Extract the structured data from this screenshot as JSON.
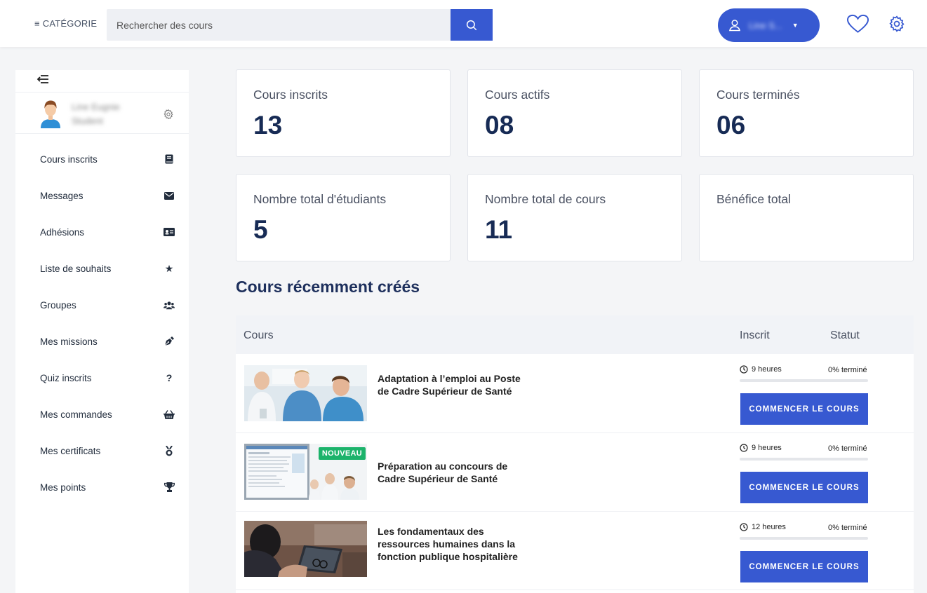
{
  "header": {
    "category_label": "CATÉGORIE",
    "search_placeholder": "Rechercher des cours",
    "user_name": "Line S..."
  },
  "sidebar": {
    "profile_name_line1": "Line Eugnie",
    "profile_name_line2": "Student",
    "items": [
      {
        "label": "Cours inscrits",
        "icon": "book-icon"
      },
      {
        "label": "Messages",
        "icon": "envelope-icon"
      },
      {
        "label": "Adhésions",
        "icon": "id-card-icon"
      },
      {
        "label": "Liste de souhaits",
        "icon": "star-icon"
      },
      {
        "label": "Groupes",
        "icon": "users-icon"
      },
      {
        "label": "Mes missions",
        "icon": "pen-nib-icon"
      },
      {
        "label": "Quiz inscrits",
        "icon": "question-icon"
      },
      {
        "label": "Mes commandes",
        "icon": "basket-icon"
      },
      {
        "label": "Mes certificats",
        "icon": "medal-icon"
      },
      {
        "label": "Mes points",
        "icon": "trophy-icon"
      }
    ]
  },
  "stats": [
    {
      "label": "Cours inscrits",
      "value": "13"
    },
    {
      "label": "Cours actifs",
      "value": "08"
    },
    {
      "label": "Cours terminés",
      "value": "06"
    },
    {
      "label": "Nombre total d'étudiants",
      "value": "5"
    },
    {
      "label": "Nombre total de cours",
      "value": "11"
    },
    {
      "label": "Bénéfice total",
      "value": ""
    }
  ],
  "recent": {
    "title": "Cours récemment créés",
    "col_course": "Cours",
    "col_enrolled": "Inscrit",
    "col_status": "Statut",
    "rows": [
      {
        "title": "Adaptation à l’emploi au Poste de Cadre Supérieur de Santé",
        "duration": "9 heures",
        "progress": "0% terminé",
        "progress_value": 0,
        "button": "COMMENCER LE COURS",
        "badge": ""
      },
      {
        "title": "Préparation au concours de Cadre Supérieur de Santé",
        "duration": "9 heures",
        "progress": "0% terminé",
        "progress_value": 0,
        "button": "COMMENCER LE COURS",
        "badge": "NOUVEAU"
      },
      {
        "title": "Les fondamentaux des ressources humaines dans la fonction publique hospitalière",
        "duration": "12 heures",
        "progress": "0% terminé",
        "progress_value": 0,
        "button": "COMMENCER LE COURS",
        "badge": ""
      }
    ]
  },
  "colors": {
    "accent": "#3759d1",
    "badge": "#1cb36b",
    "stat_value": "#172b55"
  }
}
